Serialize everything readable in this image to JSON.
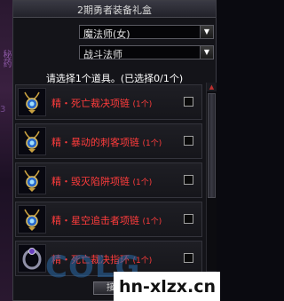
{
  "background": {
    "side_text": "秘药",
    "side_text2": "3"
  },
  "dialog": {
    "title": "2期勇者装备礼盒",
    "class_select": {
      "value": "魔法师(女)"
    },
    "subclass_select": {
      "value": "战斗法师"
    },
    "instruction": "请选择1个道具。(已选择0/1个)",
    "items": [
      {
        "name": "精・死亡裁决项链",
        "qty": "(1个)",
        "icon": "necklace-icon",
        "checked": false
      },
      {
        "name": "精・暴动的刺客项链",
        "qty": "(1个)",
        "icon": "necklace-icon",
        "checked": false
      },
      {
        "name": "精・毁灭陷阱项链",
        "qty": "(1个)",
        "icon": "necklace-icon",
        "checked": false
      },
      {
        "name": "精・星空追击者项链",
        "qty": "(1个)",
        "icon": "necklace-icon",
        "checked": false
      },
      {
        "name": "精・死亡裁决指环",
        "qty": "(1个)",
        "icon": "ring-icon",
        "checked": false
      }
    ],
    "confirm_label": "接收"
  },
  "watermark": {
    "faded": "COLG",
    "site": "hn-xlzx.cn"
  },
  "colors": {
    "item_text": "#ff3c3c",
    "panel": "#141419",
    "border": "#3c3c44"
  }
}
